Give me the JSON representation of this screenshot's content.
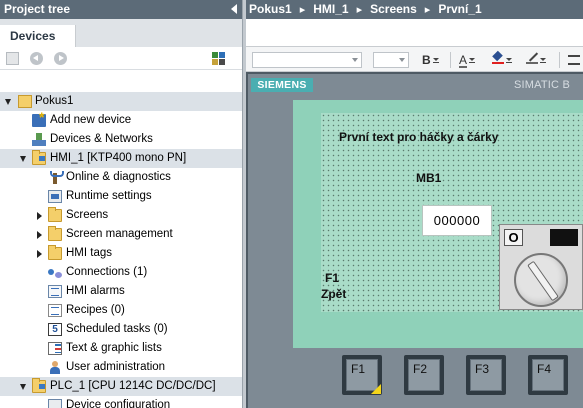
{
  "project_tree": {
    "title": "Project tree",
    "tab": "Devices",
    "items": [
      {
        "label": "Pokus1"
      },
      {
        "label": "Add new device"
      },
      {
        "label": "Devices & Networks"
      },
      {
        "label": "HMI_1 [KTP400 mono PN]"
      },
      {
        "label": "Online & diagnostics"
      },
      {
        "label": "Runtime settings"
      },
      {
        "label": "Screens"
      },
      {
        "label": "Screen management"
      },
      {
        "label": "HMI tags"
      },
      {
        "label": "Connections (1)"
      },
      {
        "label": "HMI alarms"
      },
      {
        "label": "Recipes (0)"
      },
      {
        "label": "Scheduled tasks (0)"
      },
      {
        "label": "Text & graphic lists"
      },
      {
        "label": "User administration"
      },
      {
        "label": "PLC_1 [CPU 1214C DC/DC/DC]"
      },
      {
        "label": "Device configuration"
      }
    ]
  },
  "breadcrumb": {
    "parts": [
      "Pokus1",
      "HMI_1",
      "Screens",
      "První_1"
    ],
    "separator": "▸"
  },
  "format_toolbar": {
    "bold_label": "B",
    "font_color_label": "A"
  },
  "device": {
    "brand": "SIEMENS",
    "model_prefix": "SIMATIC B",
    "screen": {
      "title_text": "První text pro háčky a čárky",
      "io_label": "MB1",
      "io_value": "000000",
      "switch_off_label": "O",
      "fkey_label": "F1",
      "fkey_text": "Zpět"
    },
    "function_keys": [
      "F1",
      "F2",
      "F3",
      "F4"
    ]
  },
  "colors": {
    "header_bg": "#5c6b78",
    "screen_bg": "#8fd1b9",
    "siemens_teal": "#4aaeb1",
    "selection": "#dbe1e7"
  }
}
